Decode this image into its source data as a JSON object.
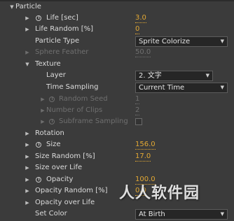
{
  "group": {
    "label": "Particle"
  },
  "rows": {
    "life": {
      "label": "Life [sec]",
      "value": "3.0"
    },
    "life_random": {
      "label": "Life Random [%]",
      "value": "0"
    },
    "particle_type": {
      "label": "Particle Type",
      "value": "Sprite Colorize"
    },
    "sphere_feather": {
      "label": "Sphere Feather",
      "value": "50.0"
    },
    "texture": {
      "label": "Texture"
    },
    "layer": {
      "label": "Layer",
      "value": "2. 文字"
    },
    "time_sampling": {
      "label": "Time Sampling",
      "value": "Current Time"
    },
    "random_seed": {
      "label": "Random Seed",
      "value": "1"
    },
    "number_of_clips": {
      "label": "Number of Clips",
      "value": "2"
    },
    "subframe_sampling": {
      "label": "Subframe Sampling"
    },
    "rotation": {
      "label": "Rotation"
    },
    "size": {
      "label": "Size",
      "value": "156.0"
    },
    "size_random": {
      "label": "Size Random [%]",
      "value": "17.0"
    },
    "size_over_life": {
      "label": "Size over Life"
    },
    "opacity": {
      "label": "Opacity",
      "value": "100.0"
    },
    "opacity_random": {
      "label": "Opacity Random [%]",
      "value": "0.0"
    },
    "opacity_over_life": {
      "label": "Opacity over Life"
    },
    "set_color": {
      "label": "Set Color",
      "value": "At Birth"
    }
  },
  "watermark": "人人软件园",
  "icons": {
    "expanded": "triangle-down-icon",
    "collapsed": "triangle-right-icon",
    "stopwatch": "stopwatch-icon",
    "dropdown": "chevron-down-icon"
  },
  "colors": {
    "background": "#3b3b3b",
    "value": "#e2a834",
    "text": "#dcdcdc",
    "disabled": "#6f6f6f",
    "dropdown_bg": "#262626"
  }
}
